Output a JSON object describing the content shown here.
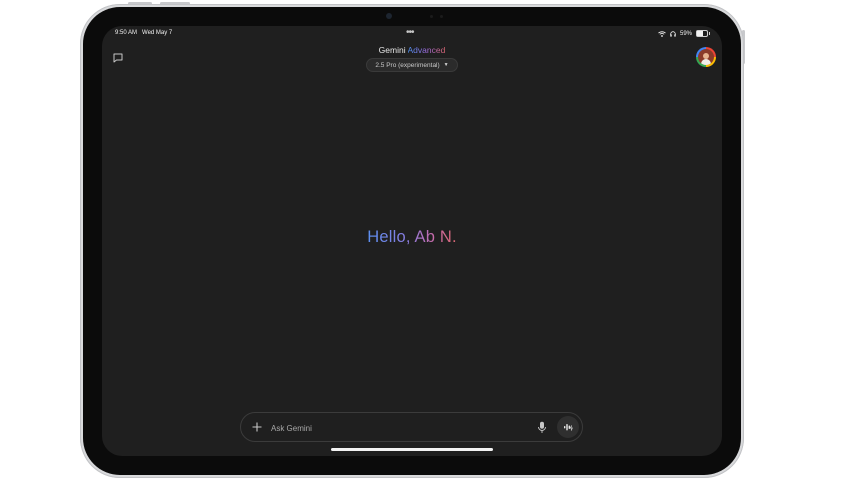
{
  "status_bar": {
    "time": "9:50 AM",
    "date": "Wed May 7",
    "battery_percent": "59%",
    "battery_level": 0.59,
    "icons": [
      "wifi-icon",
      "headphones-icon",
      "battery-icon"
    ]
  },
  "header": {
    "title": "Gemini",
    "title_suffix": "Advanced",
    "model_selector": "2.5 Pro (experimental)",
    "more_icon": "more-horizontal-icon",
    "new_chat_icon": "chat-bubble-icon",
    "avatar_icon": "user-avatar"
  },
  "main": {
    "greeting": "Hello, Ab N."
  },
  "input_bar": {
    "placeholder": "Ask Gemini",
    "value": "",
    "add_icon": "plus-icon",
    "mic_icon": "microphone-icon",
    "live_icon": "live-waveform-icon"
  },
  "colors": {
    "screen_bg": "#1f1f1f",
    "gradient_start": "#5b8ff0",
    "gradient_mid": "#8a7ce0",
    "gradient_end": "#d9676e"
  }
}
